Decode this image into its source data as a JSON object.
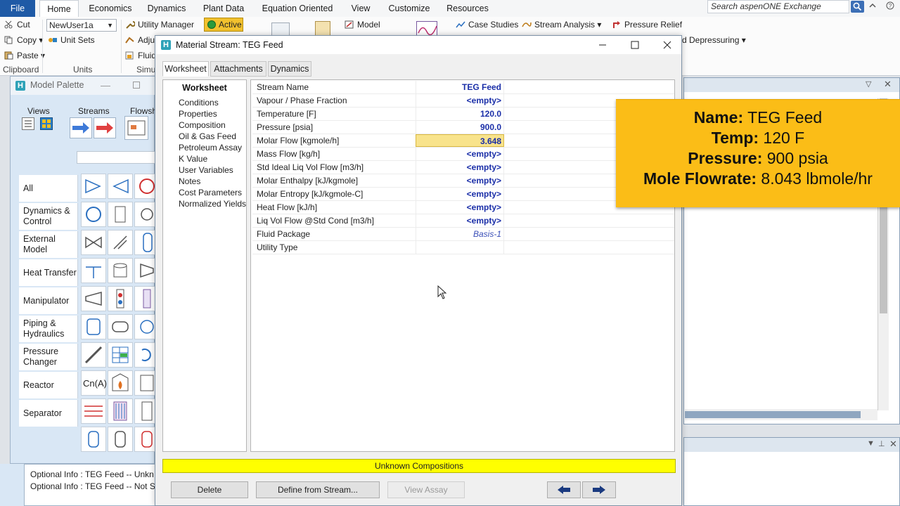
{
  "ribbon": {
    "tabs": [
      "File",
      "Home",
      "Economics",
      "Dynamics",
      "Plant Data",
      "Equation Oriented",
      "View",
      "Customize",
      "Resources"
    ],
    "search_placeholder": "Search aspenONE Exchange",
    "clipboard": {
      "cut": "Cut",
      "copy": "Copy",
      "paste": "Paste",
      "label": "Clipboard"
    },
    "units": {
      "unit_set": "NewUser1a",
      "unit_sets": "Unit Sets",
      "label": "Units"
    },
    "utility_manager": "Utility Manager",
    "active": "Active",
    "adjust": "Adju",
    "fluid": "Fluid",
    "simulation": "Simu",
    "model": "Model",
    "case_studies": "Case Studies",
    "stream_analysis": "Stream Analysis",
    "pressure_relief": "Pressure Relief",
    "depressuring": "d Depressuring"
  },
  "palette": {
    "title": "Model Palette",
    "views_label": "Views",
    "streams_label": "Streams",
    "flowsheet_label": "Flowsh",
    "categories": [
      "All",
      "Dynamics & Control",
      "External Model",
      "Heat Transfer",
      "Manipulator",
      "Piping & Hydraulics",
      "Pressure Changer",
      "Reactor",
      "Separator"
    ],
    "formula_icon": "Cn(A)"
  },
  "messages": [
    "Optional Info  : TEG Feed -- Unkn",
    "Optional Info  : TEG Feed -- Not S"
  ],
  "dialog": {
    "title": "Material Stream: TEG Feed",
    "tabs": [
      "Worksheet",
      "Attachments",
      "Dynamics"
    ],
    "nav_header": "Worksheet",
    "nav_items": [
      "Conditions",
      "Properties",
      "Composition",
      "Oil & Gas Feed",
      "Petroleum Assay",
      "K Value",
      "User Variables",
      "Notes",
      "Cost Parameters",
      "Normalized Yields"
    ],
    "rows": [
      {
        "label": "Stream Name",
        "value": "TEG Feed"
      },
      {
        "label": "Vapour / Phase Fraction",
        "value": "<empty>"
      },
      {
        "label": "Temperature [F]",
        "value": "120.0"
      },
      {
        "label": "Pressure [psia]",
        "value": "900.0"
      },
      {
        "label": "Molar Flow [kgmole/h]",
        "value": "3.648"
      },
      {
        "label": "Mass Flow [kg/h]",
        "value": "<empty>"
      },
      {
        "label": "Std Ideal Liq Vol Flow [m3/h]",
        "value": "<empty>"
      },
      {
        "label": "Molar Enthalpy [kJ/kgmole]",
        "value": "<empty>"
      },
      {
        "label": "Molar Entropy [kJ/kgmole-C]",
        "value": "<empty>"
      },
      {
        "label": "Heat Flow [kJ/h]",
        "value": "<empty>"
      },
      {
        "label": "Liq Vol Flow @Std Cond [m3/h]",
        "value": "<empty>"
      },
      {
        "label": "Fluid Package",
        "value": "Basis-1"
      },
      {
        "label": "Utility Type",
        "value": ""
      }
    ],
    "status": "Unknown Compositions",
    "buttons": {
      "delete": "Delete",
      "define": "Define from Stream...",
      "view_assay": "View Assay"
    }
  },
  "callout": [
    {
      "key": "Name:",
      "value": " TEG Feed"
    },
    {
      "key": "Temp:",
      "value": " 120 F"
    },
    {
      "key": "Pressure:",
      "value": " 900 psia"
    },
    {
      "key": "Mole Flowrate:",
      "value": " 8.043 lbmole/hr"
    }
  ],
  "colors": {
    "accent": "#1f5aa6",
    "callout": "#fbbd17",
    "status": "#ffff00",
    "highlight": "#f8e38c"
  }
}
